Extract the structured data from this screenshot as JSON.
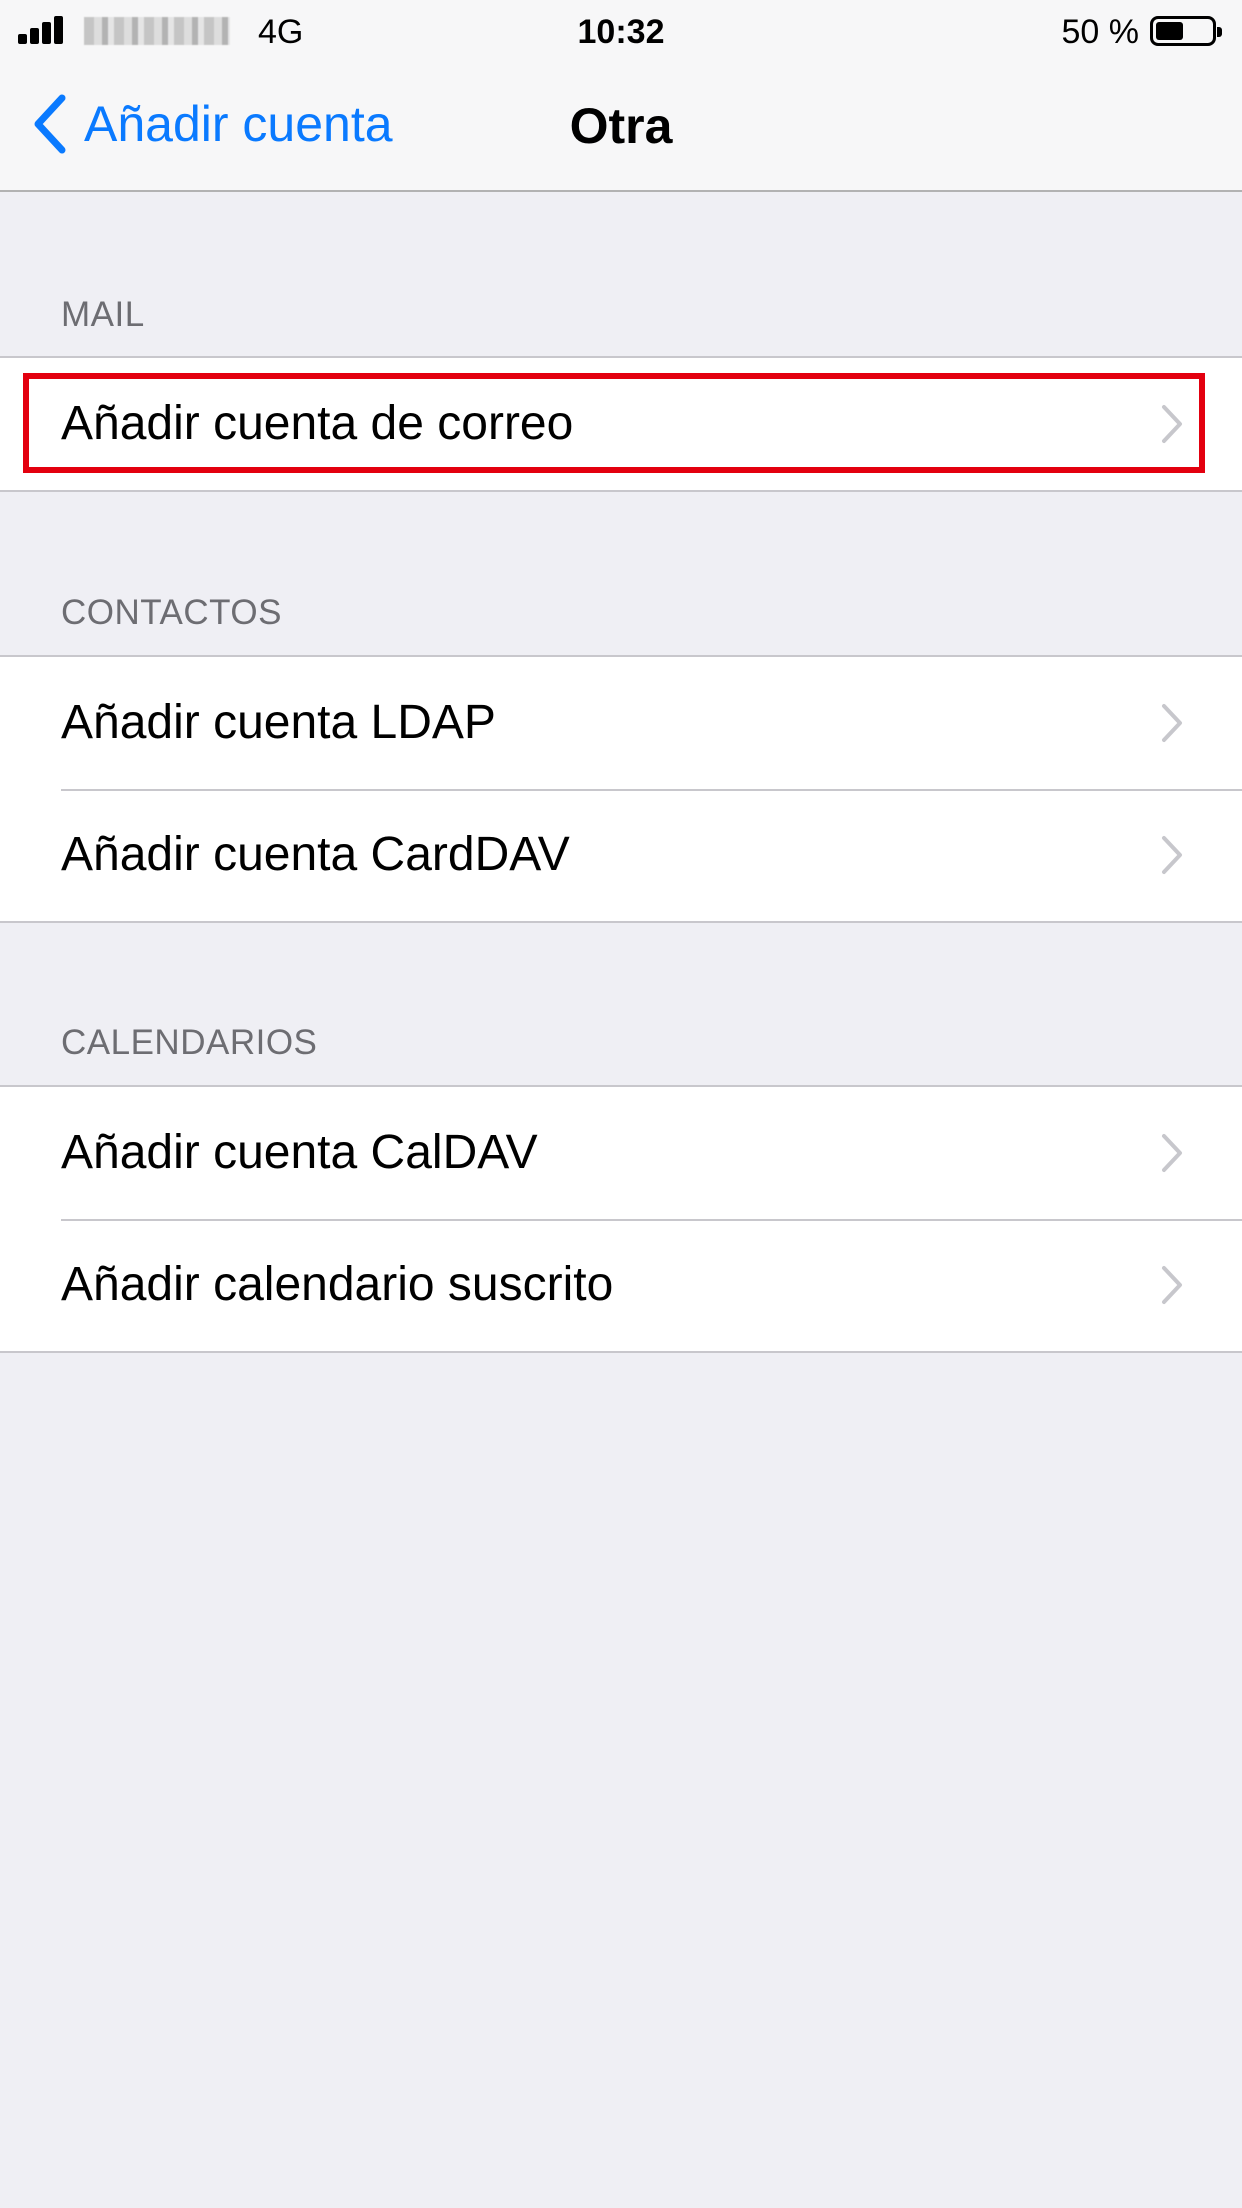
{
  "status_bar": {
    "network": "4G",
    "time": "10:32",
    "battery_percent": "50 %",
    "battery_level": 0.5
  },
  "nav": {
    "back_label": "Añadir cuenta",
    "title": "Otra"
  },
  "sections": [
    {
      "header": "MAIL",
      "items": [
        {
          "label": "Añadir cuenta de correo"
        }
      ]
    },
    {
      "header": "CONTACTOS",
      "items": [
        {
          "label": "Añadir cuenta LDAP"
        },
        {
          "label": "Añadir cuenta CardDAV"
        }
      ]
    },
    {
      "header": "CALENDARIOS",
      "items": [
        {
          "label": "Añadir cuenta CalDAV"
        },
        {
          "label": "Añadir calendario suscrito"
        }
      ]
    }
  ],
  "colors": {
    "accent": "#0a7aff",
    "highlight": "#e3000f",
    "background": "#efeff4"
  },
  "icons": {
    "back": "chevron-left-icon",
    "disclosure": "chevron-right-icon",
    "battery": "battery-icon",
    "signal": "signal-bars-icon"
  }
}
